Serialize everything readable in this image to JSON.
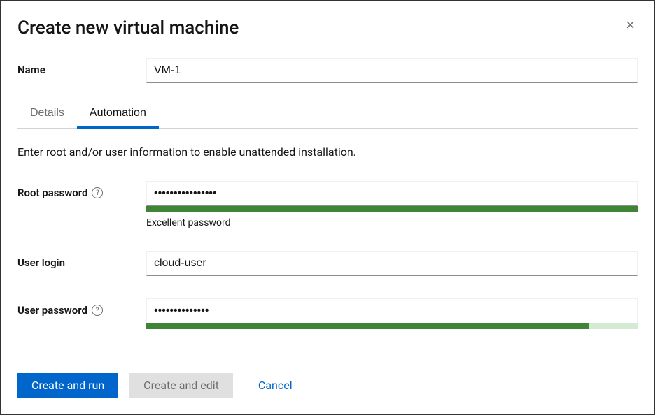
{
  "dialog": {
    "title": "Create new virtual machine"
  },
  "form": {
    "name_label": "Name",
    "name_value": "VM-1"
  },
  "tabs": {
    "details": "Details",
    "automation": "Automation"
  },
  "automation": {
    "instruction": "Enter root and/or user information to enable unattended installation.",
    "root_password_label": "Root password",
    "root_password_value": "••••••••••••••••",
    "root_password_strength_percent": 100,
    "root_password_strength_text": "Excellent password",
    "user_login_label": "User login",
    "user_login_value": "cloud-user",
    "user_password_label": "User password",
    "user_password_value": "••••••••••••••",
    "user_password_strength_percent": 90
  },
  "buttons": {
    "create_run": "Create and run",
    "create_edit": "Create and edit",
    "cancel": "Cancel"
  },
  "colors": {
    "primary": "#06c",
    "strength_green": "#3e8635"
  }
}
